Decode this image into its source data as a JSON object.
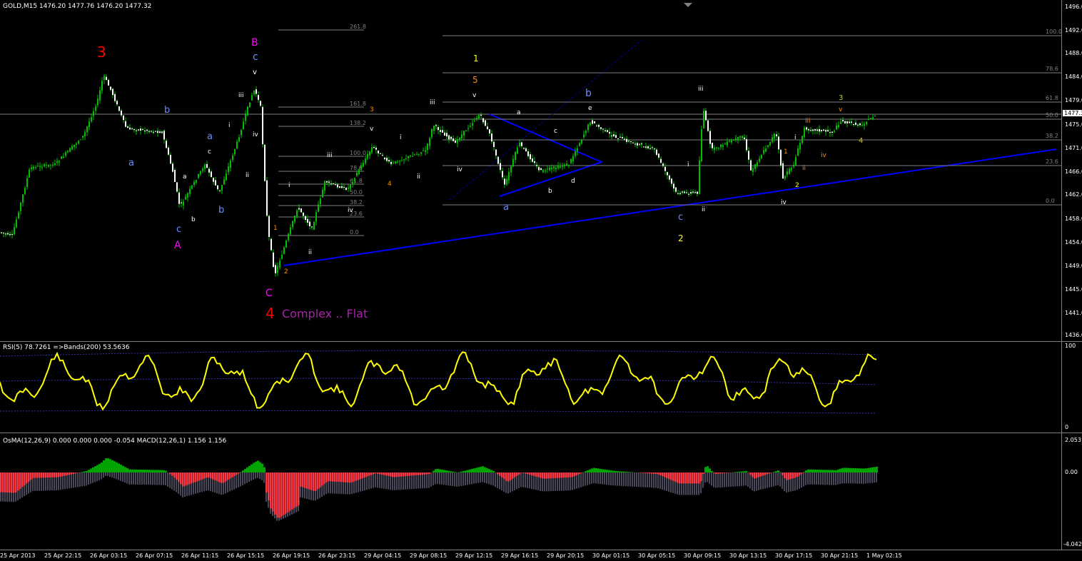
{
  "chart_title": "GOLD,M15  1476.20 1477.76 1476.20 1477.32",
  "current_price": "1477.32",
  "price_axis": [
    "1496.0",
    "1492.0",
    "1488.0",
    "1484.0",
    "1479.0",
    "1475.0",
    "1471.0",
    "1466.0",
    "1462.0",
    "1458.0",
    "1454.0",
    "1449.0",
    "1445.0",
    "1441.0",
    "1436.0"
  ],
  "rsi_label": "RSI(5) 78.7261  =>Bands(200) 53.5636",
  "rsi_axis": [
    "100",
    "0"
  ],
  "macd_label": "OsMA(12,26,9) 0.000 0.000 0.000 -0.054  MACD(12,26,1) 1.156 1.156",
  "macd_axis": [
    "2.053",
    "0.00",
    "-4.042"
  ],
  "time_axis": [
    "25 Apr 2013",
    "25 Apr 22:15",
    "26 Apr 03:15",
    "26 Apr 07:15",
    "26 Apr 11:15",
    "26 Apr 15:15",
    "26 Apr 19:15",
    "26 Apr 23:15",
    "29 Apr 04:15",
    "29 Apr 08:15",
    "29 Apr 12:15",
    "29 Apr 16:15",
    "29 Apr 20:15",
    "30 Apr 01:15",
    "30 Apr 05:15",
    "30 Apr 09:15",
    "30 Apr 13:15",
    "30 Apr 17:15",
    "30 Apr 21:15",
    "1 May 02:15"
  ],
  "fib_small": [
    "261.8",
    "161.8",
    "138.2",
    "100.0",
    "78.6",
    "61.8",
    "50.0",
    "38.2",
    "23.6",
    "0.0"
  ],
  "fib_large": [
    "100.0",
    "78.6",
    "61.8",
    "50.0",
    "38.2",
    "23.6",
    "0.0"
  ],
  "annotations": {
    "wave_3_red": "3",
    "wave_B": "B",
    "wave_c_top": "c",
    "wave_v_top": "v",
    "wave_A": "A",
    "wave_C": "C",
    "wave_4": "4",
    "complex_flat": "Complex .. Flat",
    "wave_1_yellow": "1",
    "wave_5_orange": "5",
    "wave_b_blue": "b",
    "wave_2_yellow": "2",
    "wave_3_right": "3",
    "wave_4_right": "4"
  },
  "colors": {
    "up": "#00c000",
    "down": "#ffffff",
    "rsi": "#ffff00",
    "trend": "#0000ff",
    "fib": "#808080",
    "osma_up": "#00c000",
    "osma_down": "#ff0000"
  }
}
